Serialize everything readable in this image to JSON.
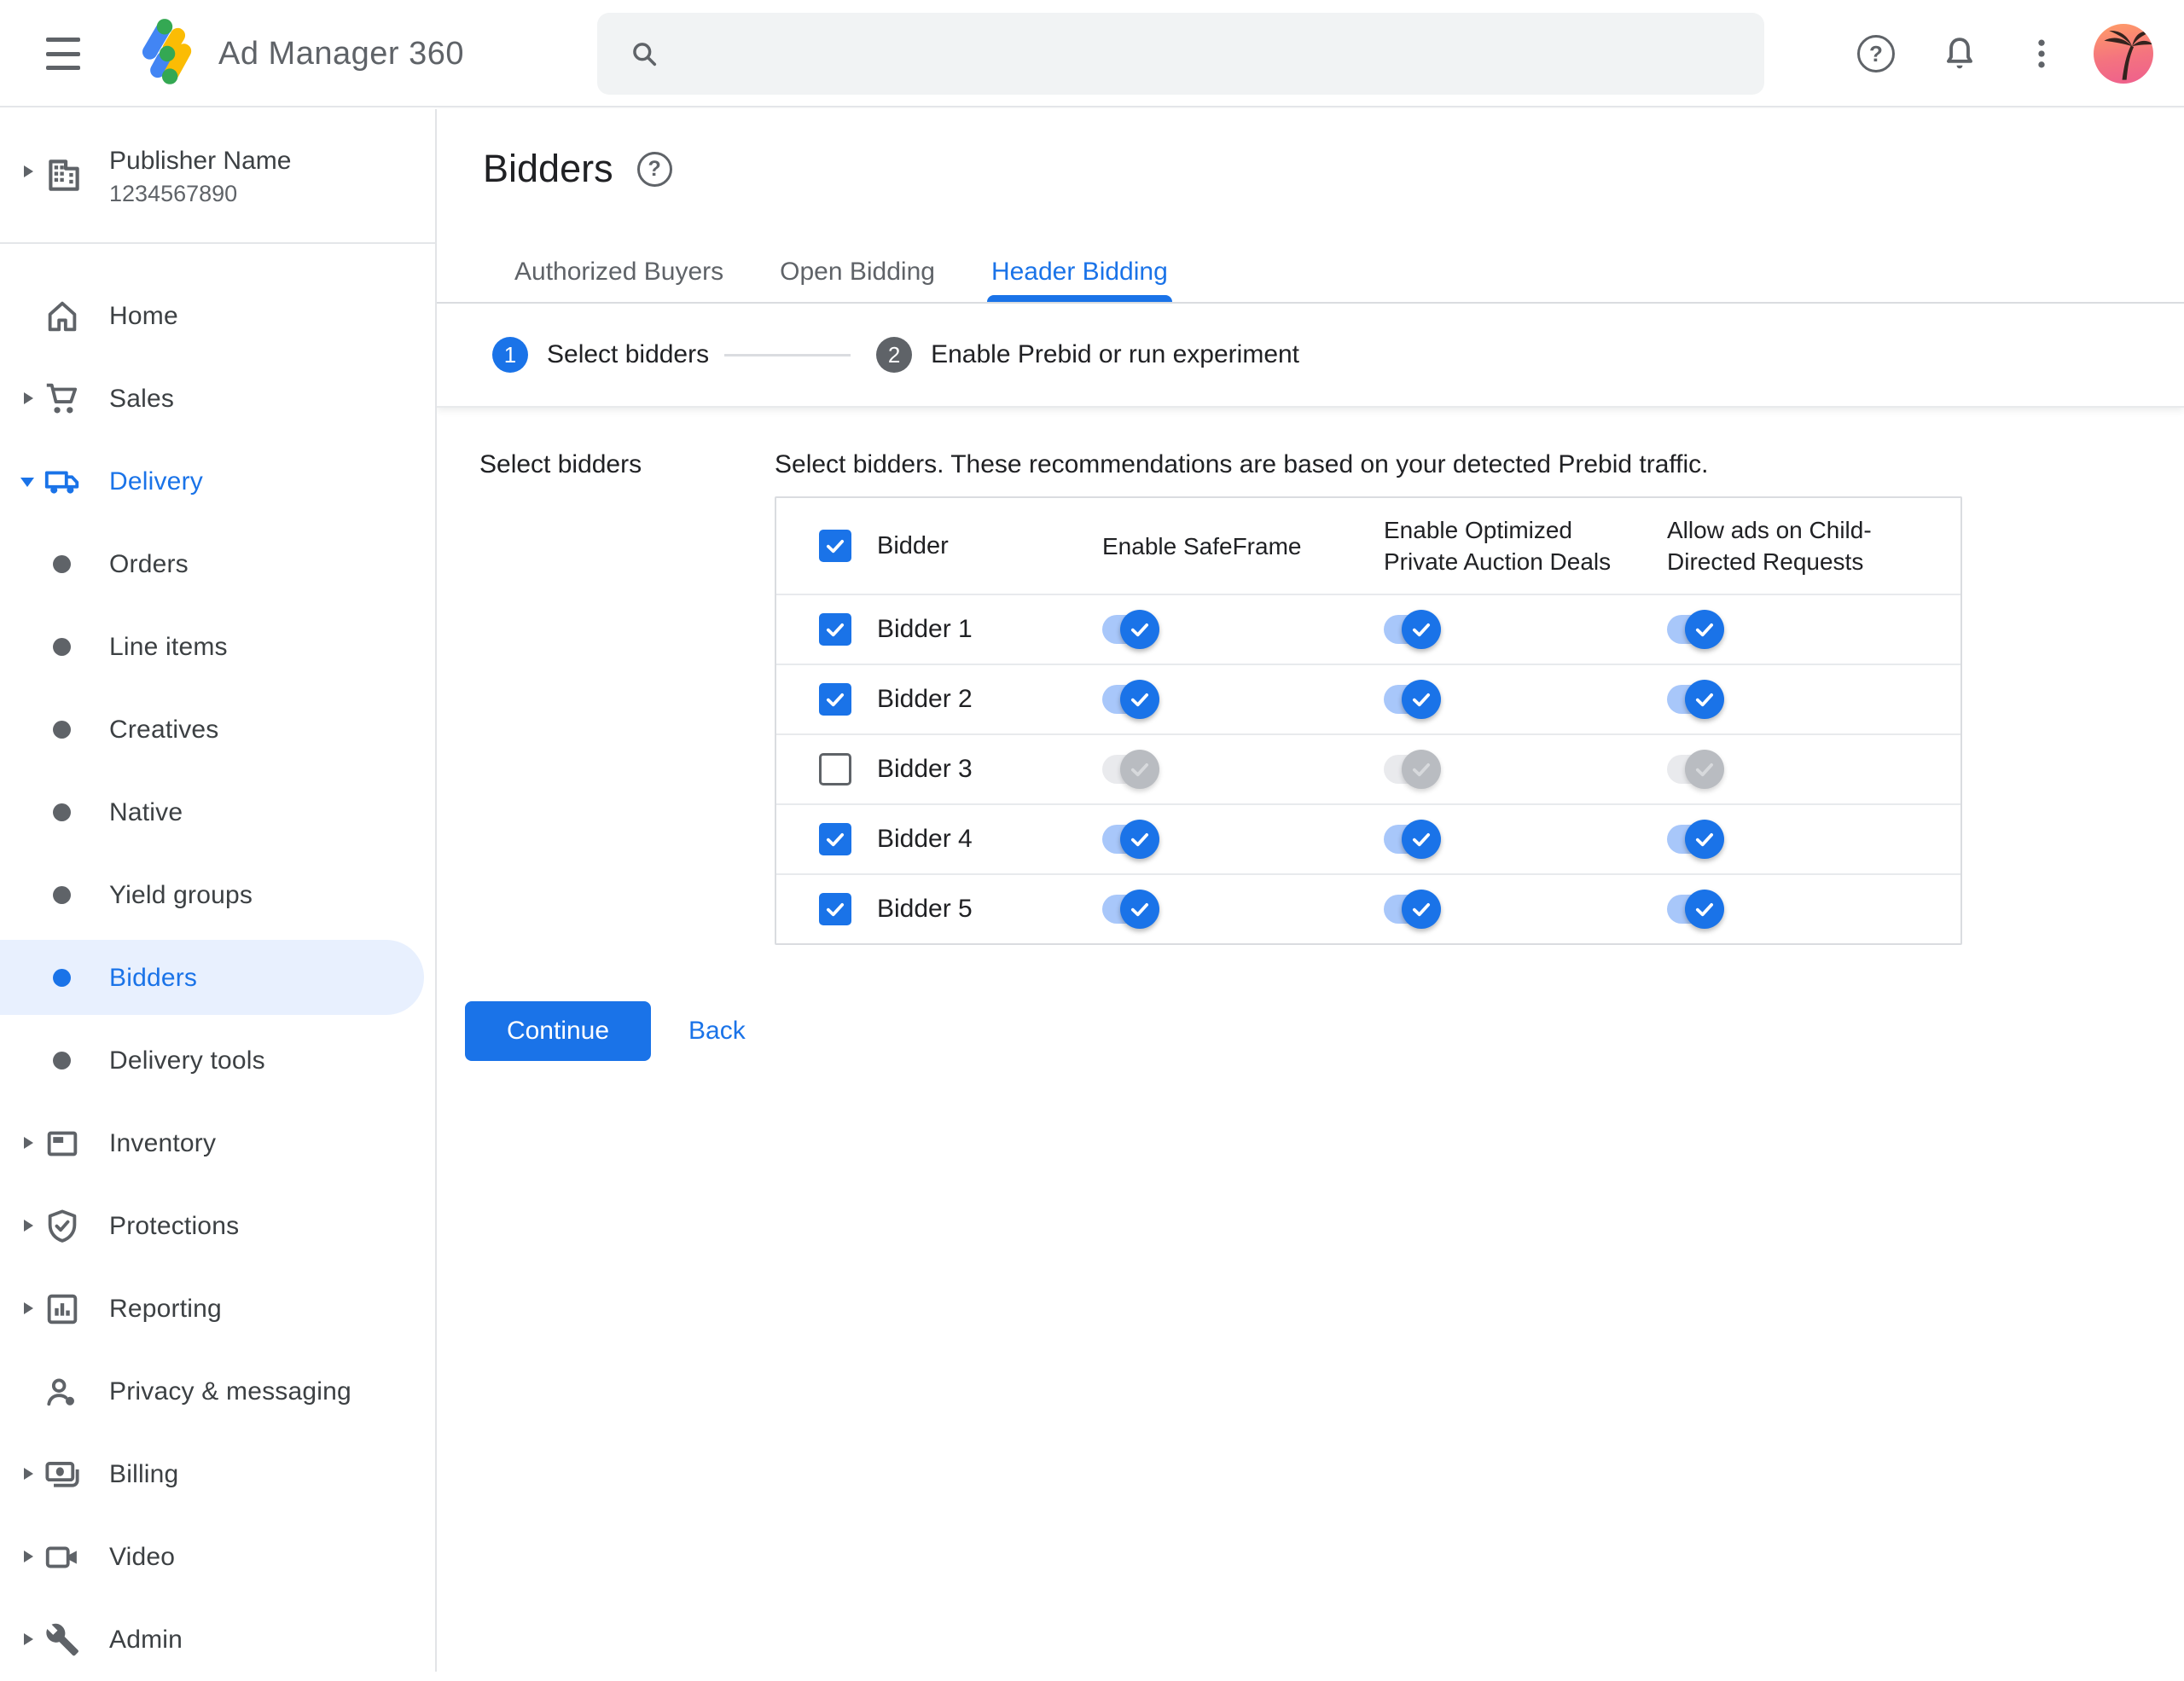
{
  "topbar": {
    "app_name": "Ad Manager 360",
    "search": {
      "placeholder": "",
      "value": ""
    }
  },
  "publisher": {
    "name": "Publisher Name",
    "id": "1234567890"
  },
  "sidebar": {
    "items": [
      {
        "label": "Home",
        "type": "top",
        "icon": "home",
        "caret": false
      },
      {
        "label": "Sales",
        "type": "top",
        "icon": "cart",
        "caret": true
      },
      {
        "label": "Delivery",
        "type": "top",
        "icon": "truck",
        "caret": "down",
        "active_section": true
      },
      {
        "label": "Orders",
        "type": "sub"
      },
      {
        "label": "Line items",
        "type": "sub"
      },
      {
        "label": "Creatives",
        "type": "sub"
      },
      {
        "label": "Native",
        "type": "sub"
      },
      {
        "label": "Yield groups",
        "type": "sub"
      },
      {
        "label": "Bidders",
        "type": "sub",
        "selected": true
      },
      {
        "label": "Delivery tools",
        "type": "sub"
      },
      {
        "label": "Inventory",
        "type": "top",
        "icon": "inventory",
        "caret": true
      },
      {
        "label": "Protections",
        "type": "top",
        "icon": "shield",
        "caret": true
      },
      {
        "label": "Reporting",
        "type": "top",
        "icon": "report",
        "caret": true
      },
      {
        "label": "Privacy & messaging",
        "type": "top",
        "icon": "person",
        "caret": false
      },
      {
        "label": "Billing",
        "type": "top",
        "icon": "money",
        "caret": true
      },
      {
        "label": "Video",
        "type": "top",
        "icon": "video",
        "caret": true
      },
      {
        "label": "Admin",
        "type": "top",
        "icon": "wrench",
        "caret": true
      }
    ]
  },
  "page": {
    "title": "Bidders",
    "tabs": [
      {
        "label": "Authorized Buyers",
        "active": false
      },
      {
        "label": "Open Bidding",
        "active": false
      },
      {
        "label": "Header Bidding",
        "active": true
      }
    ],
    "steps": [
      {
        "number": "1",
        "label": "Select bidders",
        "state": "active"
      },
      {
        "number": "2",
        "label": "Enable Prebid or run experiment",
        "state": "inactive"
      }
    ]
  },
  "content": {
    "section_label": "Select bidders",
    "description": "Select bidders. These recommendations are based on your detected Prebid traffic.",
    "table": {
      "select_all_checked": true,
      "columns": [
        "Bidder",
        "Enable SafeFrame",
        "Enable Optimized Private Auction Deals",
        "Allow ads on Child-Directed Requests"
      ],
      "rows": [
        {
          "name": "Bidder 1",
          "selected": true,
          "enable_safeframe": "on",
          "enable_optimized_private_auction_deals": "on",
          "allow_ads_child_directed": "on"
        },
        {
          "name": "Bidder 2",
          "selected": true,
          "enable_safeframe": "on",
          "enable_optimized_private_auction_deals": "on",
          "allow_ads_child_directed": "on"
        },
        {
          "name": "Bidder 3",
          "selected": false,
          "enable_safeframe": "disabled",
          "enable_optimized_private_auction_deals": "disabled",
          "allow_ads_child_directed": "disabled"
        },
        {
          "name": "Bidder 4",
          "selected": true,
          "enable_safeframe": "on",
          "enable_optimized_private_auction_deals": "on",
          "allow_ads_child_directed": "on"
        },
        {
          "name": "Bidder 5",
          "selected": true,
          "enable_safeframe": "on",
          "enable_optimized_private_auction_deals": "on",
          "allow_ads_child_directed": "on"
        }
      ]
    },
    "actions": {
      "continue": "Continue",
      "back": "Back"
    }
  },
  "colors": {
    "accent": "#1a73e8",
    "toggle_track_on": "#a8c7fa",
    "toggle_track_off": "#e9eaed",
    "toggle_thumb_off": "#b9bcc1",
    "selected_item_bg": "#e8f0fe",
    "text_primary": "#202124",
    "text_secondary": "#5f6368",
    "divider": "#dadce0",
    "logo_blue": "#4285f4",
    "logo_yellow": "#fbbc04",
    "logo_green": "#34a853"
  }
}
